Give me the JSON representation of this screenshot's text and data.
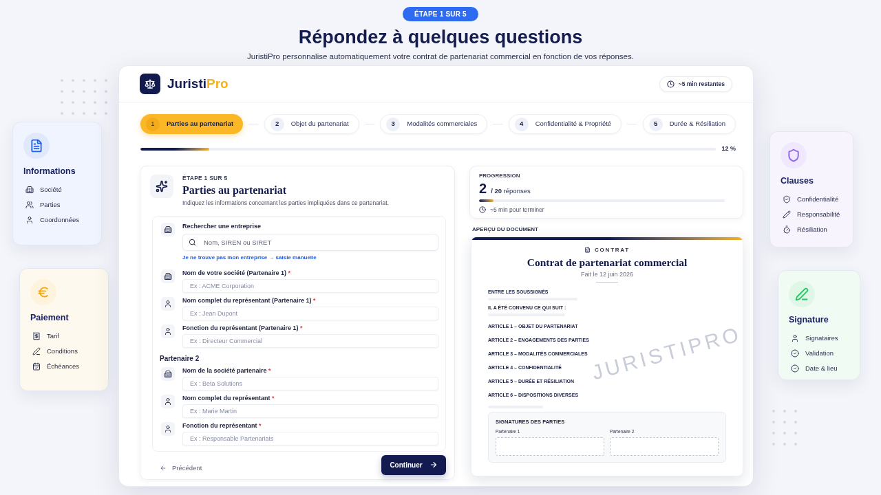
{
  "step_badge": "ÉTAPE 1 SUR 5",
  "title": "Répondez à quelques questions",
  "subtitle": "JuristiPro personnalise automatiquement votre contrat de partenariat commercial en fonction de vos réponses.",
  "left_cards": [
    {
      "title": "Informations",
      "kind": "document",
      "color": "#2563eb",
      "items": [
        {
          "label": "Société",
          "kind": "company"
        },
        {
          "label": "Parties",
          "kind": "people"
        },
        {
          "label": "Coordonnées",
          "kind": "person"
        }
      ]
    },
    {
      "title": "Paiement",
      "kind": "payment",
      "color": "#f5a70f",
      "items": [
        {
          "label": "Tarif",
          "kind": "price"
        },
        {
          "label": "Conditions",
          "kind": "pen"
        },
        {
          "label": "Échéances",
          "kind": "calendar"
        }
      ]
    }
  ],
  "app": {
    "brand": {
      "name": "Juristi",
      "accent": "Pro"
    },
    "time_left": "~5 min restantes",
    "steps": [
      {
        "number": "1",
        "label": "Parties au partenariat",
        "selected": true
      },
      {
        "number": "2",
        "label": "Objet du partenariat",
        "selected": false
      },
      {
        "number": "3",
        "label": "Modalités commerciales",
        "selected": false
      },
      {
        "number": "4",
        "label": "Confidentialité & Propriété",
        "selected": false
      },
      {
        "number": "5",
        "label": "Durée & Résiliation",
        "selected": false
      }
    ],
    "progress": {
      "level": 0.12,
      "reading": "12 %"
    },
    "form": {
      "eyebrow": "ÉTAPE 1 SUR 5",
      "title": "Parties au partenariat",
      "description": "Indiquez les informations concernant les parties impliquées dans ce partenariat.",
      "search": {
        "kind": "company",
        "label": "Rechercher une entreprise",
        "placeholder": "Nom, SIREN ou SIRET",
        "link": "Je ne trouve pas mon entreprise → saisie manuelle"
      },
      "partner_1_fields": [
        {
          "kind": "company",
          "label": "Nom de votre société (Partenaire 1)",
          "required_mark": "*",
          "placeholder": "Ex : ACME Corporation"
        },
        {
          "kind": "person",
          "label": "Nom complet du représentant (Partenaire 1)",
          "required_mark": "*",
          "placeholder": "Ex : Jean Dupont"
        },
        {
          "kind": "person",
          "label": "Fonction du représentant (Partenaire 1)",
          "required_mark": "*",
          "placeholder": "Ex : Directeur Commercial"
        }
      ],
      "partner_2_heading": "Partenaire 2",
      "partner_2_fields": [
        {
          "kind": "company",
          "label": "Nom de la société partenaire",
          "required_mark": "*",
          "placeholder": "Ex : Beta Solutions"
        },
        {
          "kind": "person",
          "label": "Nom complet du représentant",
          "required_mark": "*",
          "placeholder": "Ex : Marie Martin"
        },
        {
          "kind": "person",
          "label": "Fonction du représentant",
          "required_mark": "*",
          "placeholder": "Ex : Responsable Partenariats"
        }
      ],
      "back": "Précédent",
      "next": "Continuer"
    },
    "progression": {
      "heading": "PROGRESSION",
      "count": "2",
      "total": "**/ 20** réponses",
      "level": 0.06,
      "eta": "~5 min pour terminer"
    },
    "preview": {
      "heading": "APERÇU DU DOCUMENT",
      "doc_type": "CONTRAT",
      "title": "Contrat de partenariat commercial",
      "date": "Fait le 12 juin 2026",
      "sections": [
        "ENTRE LES SOUSSIGNÉS",
        "IL A ÉTÉ CONVENU CE QUI SUIT :"
      ],
      "articles": [
        "ARTICLE 1 – OBJET DU PARTENARIAT",
        "ARTICLE 2 – ENGAGEMENTS DES PARTIES",
        "ARTICLE 3 – MODALITÉS COMMERCIALES",
        "ARTICLE 4 – CONFIDENTIALITÉ",
        "ARTICLE 5 – DURÉE ET RÉSILIATION",
        "ARTICLE 6 – DISPOSITIONS DIVERSES"
      ],
      "watermark": "JURISTIPRO",
      "signatures": {
        "heading": "SIGNATURES DES PARTIES",
        "parties": [
          "Partenaire 1",
          "Partenaire 2"
        ]
      }
    }
  },
  "right_cards": [
    {
      "title": "Clauses",
      "kind": "clauses",
      "color": "#8b5cf6",
      "items": [
        {
          "label": "Confidentialité",
          "kind": "shield"
        },
        {
          "label": "Responsabilité",
          "kind": "pencil"
        },
        {
          "label": "Résiliation",
          "kind": "timer"
        }
      ]
    },
    {
      "title": "Signature",
      "kind": "signature",
      "color": "#22c55e",
      "items": [
        {
          "label": "Signataires",
          "kind": "person"
        },
        {
          "label": "Validation",
          "kind": "check"
        },
        {
          "label": "Date & lieu",
          "kind": "check"
        }
      ]
    }
  ]
}
